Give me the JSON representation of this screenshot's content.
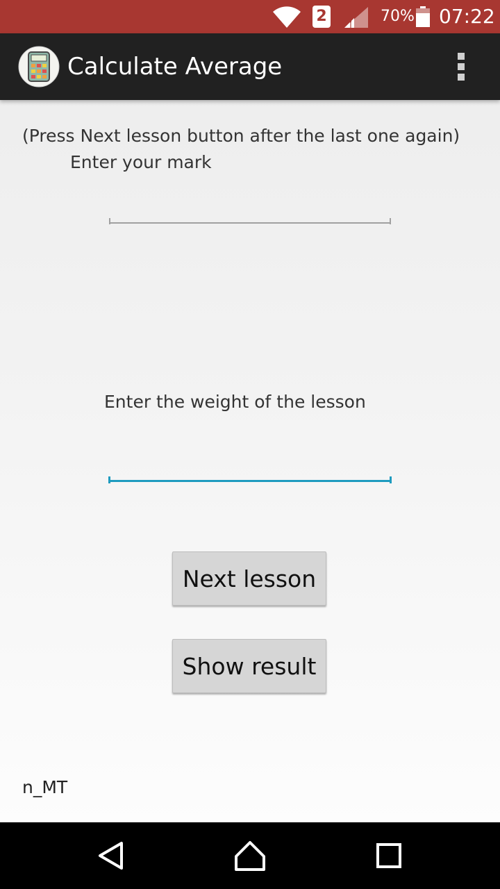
{
  "status_bar": {
    "sim_slot": "2",
    "battery_percent": "70%",
    "time": "07:22",
    "icons": [
      "wifi-icon",
      "sim-icon",
      "cell-signal-icon",
      "battery-icon"
    ]
  },
  "action_bar": {
    "title": "Calculate Average",
    "app_icon": "calculator-icon",
    "menu_icon": "overflow-menu-icon"
  },
  "form": {
    "hint": "(Press Next lesson button after the last one again)",
    "mark_label": "Enter your mark",
    "mark_value": "",
    "weight_label": "Enter the weight of the lesson",
    "weight_value": ""
  },
  "buttons": {
    "next_label": "Next lesson",
    "result_label": "Show result"
  },
  "footer": {
    "text": "n_MT"
  },
  "nav_bar": {
    "icons": [
      "back-icon",
      "home-icon",
      "recent-apps-icon"
    ]
  },
  "colors": {
    "status_bar": "#a83731",
    "action_bar": "#212121",
    "accent": "#1e9bbf",
    "button": "#d6d6d6"
  }
}
